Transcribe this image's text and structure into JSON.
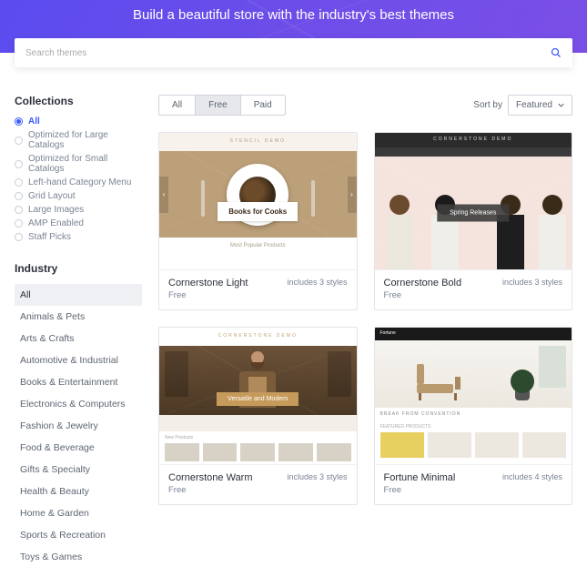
{
  "hero": {
    "title": "Build a beautiful store with the industry's best themes"
  },
  "search": {
    "placeholder": "Search themes"
  },
  "sidebar": {
    "collections_heading": "Collections",
    "collections": [
      {
        "label": "All",
        "selected": true
      },
      {
        "label": "Optimized for Large Catalogs",
        "selected": false
      },
      {
        "label": "Optimized for Small Catalogs",
        "selected": false
      },
      {
        "label": "Left-hand Category Menu",
        "selected": false
      },
      {
        "label": "Grid Layout",
        "selected": false
      },
      {
        "label": "Large Images",
        "selected": false
      },
      {
        "label": "AMP Enabled",
        "selected": false
      },
      {
        "label": "Staff Picks",
        "selected": false
      }
    ],
    "industry_heading": "Industry",
    "industries": [
      {
        "label": "All",
        "active": true
      },
      {
        "label": "Animals & Pets"
      },
      {
        "label": "Arts & Crafts"
      },
      {
        "label": "Automotive & Industrial"
      },
      {
        "label": "Books & Entertainment"
      },
      {
        "label": "Electronics & Computers"
      },
      {
        "label": "Fashion & Jewelry"
      },
      {
        "label": "Food & Beverage"
      },
      {
        "label": "Gifts & Specialty"
      },
      {
        "label": "Health & Beauty"
      },
      {
        "label": "Home & Garden"
      },
      {
        "label": "Sports & Recreation"
      },
      {
        "label": "Toys & Games"
      }
    ]
  },
  "filters": {
    "tabs": [
      {
        "label": "All"
      },
      {
        "label": "Free",
        "active": true
      },
      {
        "label": "Paid"
      }
    ],
    "sort_label": "Sort by",
    "sort_value": "Featured"
  },
  "themes": [
    {
      "name": "Cornerstone Light",
      "price": "Free",
      "styles": "includes 3 styles",
      "preview": {
        "top_text": "STENCIL DEMO",
        "badge": "Books for Cooks",
        "bottom_text": "Most Popular Products"
      }
    },
    {
      "name": "Cornerstone Bold",
      "price": "Free",
      "styles": "includes 3 styles",
      "preview": {
        "top_text": "CORNERSTONE DEMO",
        "badge": "Spring Releases"
      }
    },
    {
      "name": "Cornerstone Warm",
      "price": "Free",
      "styles": "includes 3 styles",
      "preview": {
        "top_text": "CORNERSTONE DEMO",
        "badge": "Versatile and Modern",
        "bottom_text": "New Products"
      }
    },
    {
      "name": "Fortune Minimal",
      "price": "Free",
      "styles": "includes 4 styles",
      "preview": {
        "logo": "Fortune",
        "strip": "BREAK FROM CONVENTION",
        "bottom_text": "FEATURED PRODUCTS"
      }
    }
  ]
}
